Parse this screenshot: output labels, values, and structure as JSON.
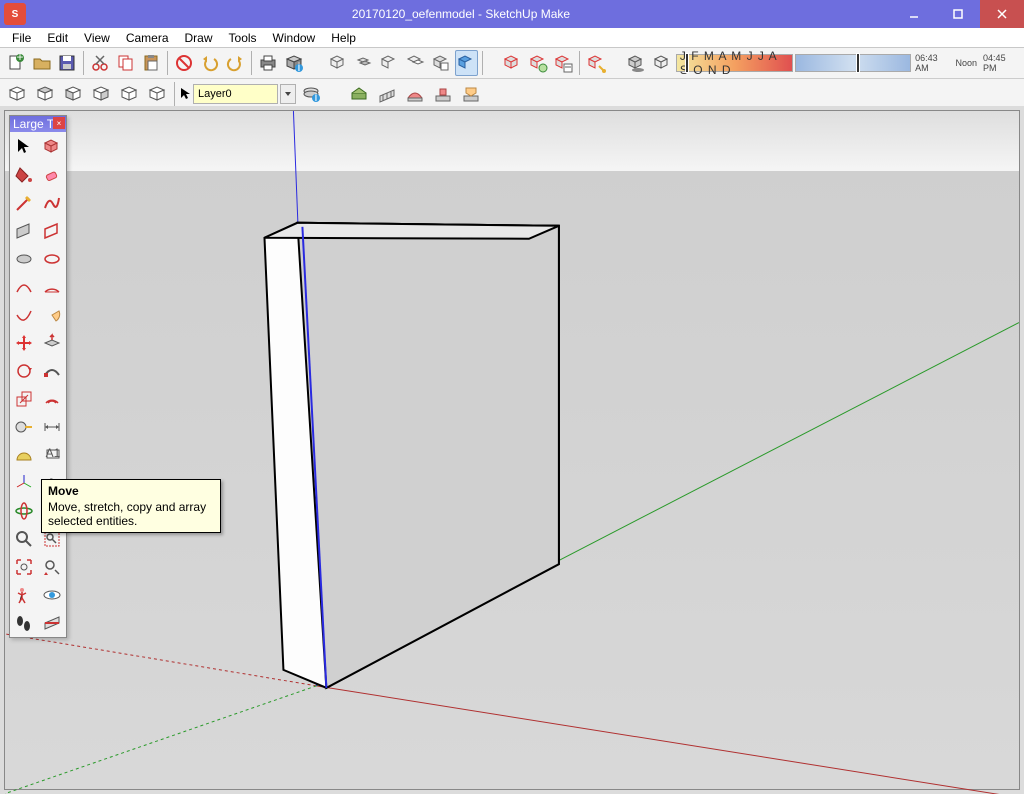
{
  "title": "20170120_oefenmodel - SketchUp Make",
  "menu": [
    "File",
    "Edit",
    "View",
    "Camera",
    "Draw",
    "Tools",
    "Window",
    "Help"
  ],
  "layer": {
    "value": "Layer0"
  },
  "palette": {
    "title": "Large T..."
  },
  "tooltip": {
    "title": "Move",
    "body": "Move, stretch, copy and array selected entities."
  },
  "months": "J F M A M J J A S O N D",
  "times": {
    "dawn": "06:43 AM",
    "noon": "Noon",
    "dusk": "04:45 PM"
  }
}
